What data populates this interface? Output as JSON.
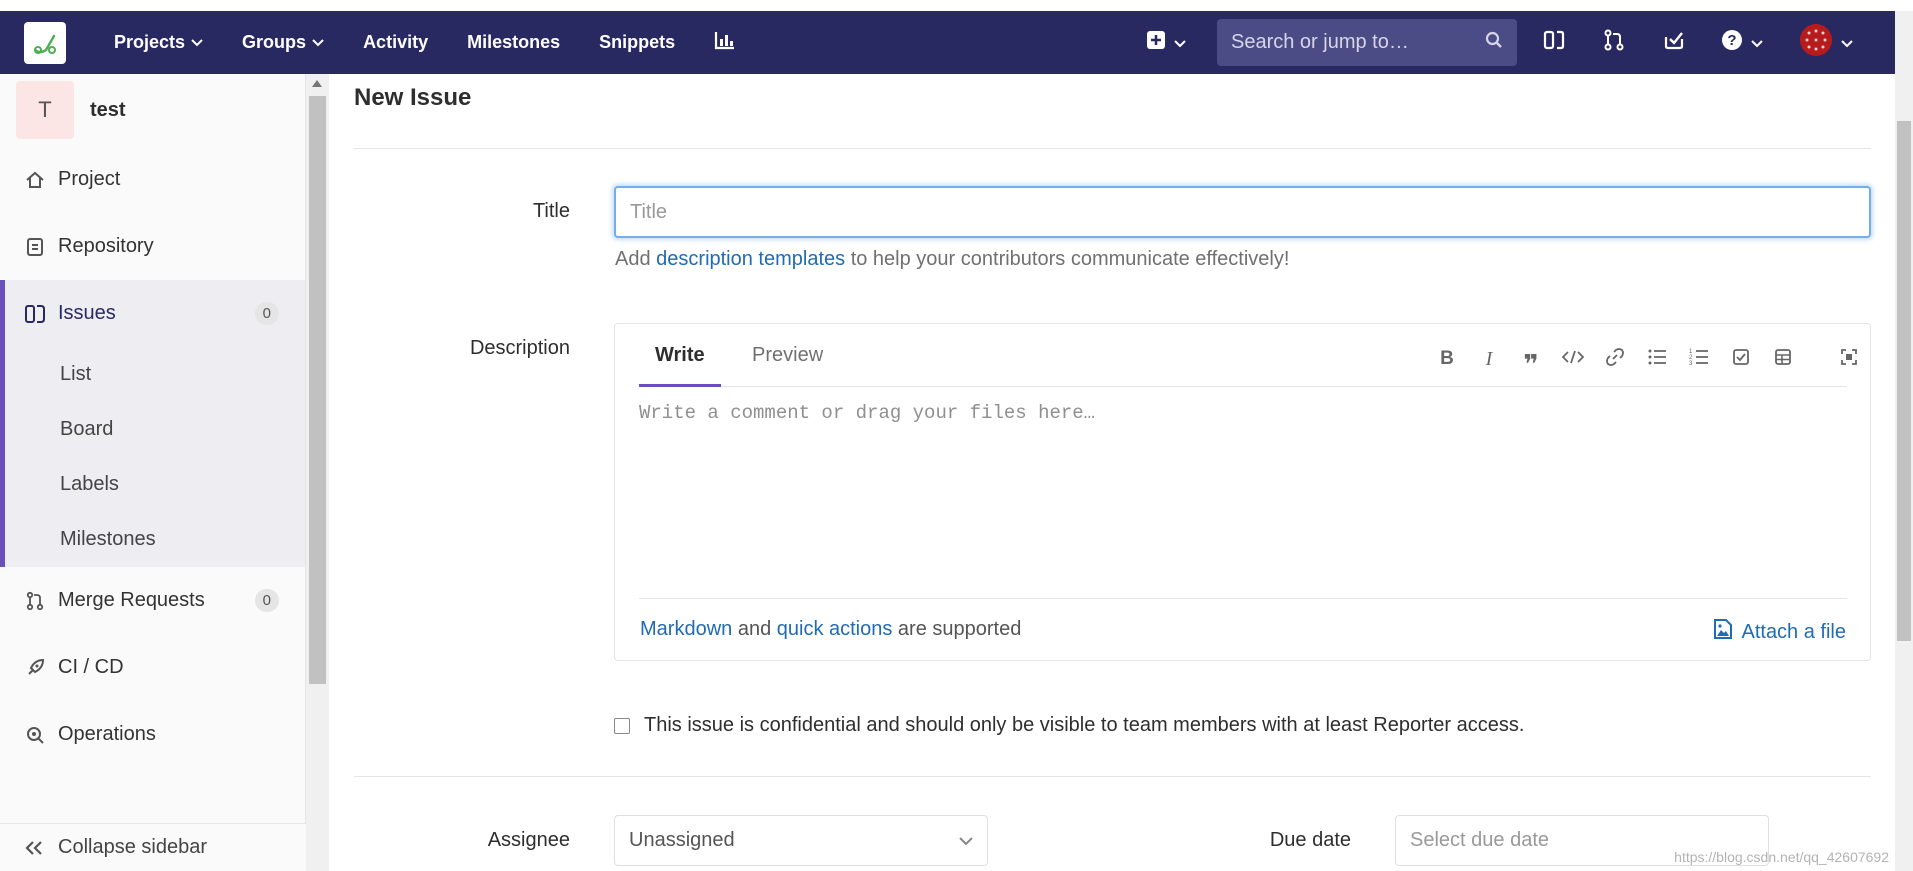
{
  "navbar": {
    "links": [
      {
        "label": "Projects",
        "dropdown": true
      },
      {
        "label": "Groups",
        "dropdown": true
      },
      {
        "label": "Activity",
        "dropdown": false
      },
      {
        "label": "Milestones",
        "dropdown": false
      },
      {
        "label": "Snippets",
        "dropdown": false
      }
    ],
    "search_placeholder": "Search or jump to…",
    "colors": {
      "bg": "#292961",
      "search_bg": "#4b4b85"
    }
  },
  "sidebar": {
    "project_initial": "T",
    "project_name": "test",
    "items": [
      {
        "label": "Project",
        "icon": "home-icon"
      },
      {
        "label": "Repository",
        "icon": "document-icon"
      },
      {
        "label": "Issues",
        "icon": "issues-icon",
        "badge": "0",
        "active": true
      },
      {
        "label": "Merge Requests",
        "icon": "merge-request-icon",
        "badge": "0"
      },
      {
        "label": "CI / CD",
        "icon": "rocket-icon"
      },
      {
        "label": "Operations",
        "icon": "operations-icon"
      }
    ],
    "issues_subitems": [
      "List",
      "Board",
      "Labels",
      "Milestones"
    ],
    "collapse_label": "Collapse sidebar"
  },
  "form": {
    "page_title": "New Issue",
    "title_label": "Title",
    "title_placeholder": "Title",
    "hint_prefix": "Add ",
    "hint_link": "description templates",
    "hint_suffix": " to help your contributors communicate effectively!",
    "description_label": "Description",
    "tab_write": "Write",
    "tab_preview": "Preview",
    "textarea_placeholder": "Write a comment or drag your files here…",
    "footer_markdown": "Markdown",
    "footer_and": " and ",
    "footer_quick_actions": "quick actions",
    "footer_supported": " are supported",
    "attach_label": "Attach a file",
    "confidential_label": "This issue is confidential and should only be visible to team members with at least Reporter access.",
    "assignee_label": "Assignee",
    "assignee_value": "Unassigned",
    "due_date_label": "Due date",
    "due_date_placeholder": "Select due date"
  },
  "watermark": "https://blog.csdn.net/qq_42607692"
}
